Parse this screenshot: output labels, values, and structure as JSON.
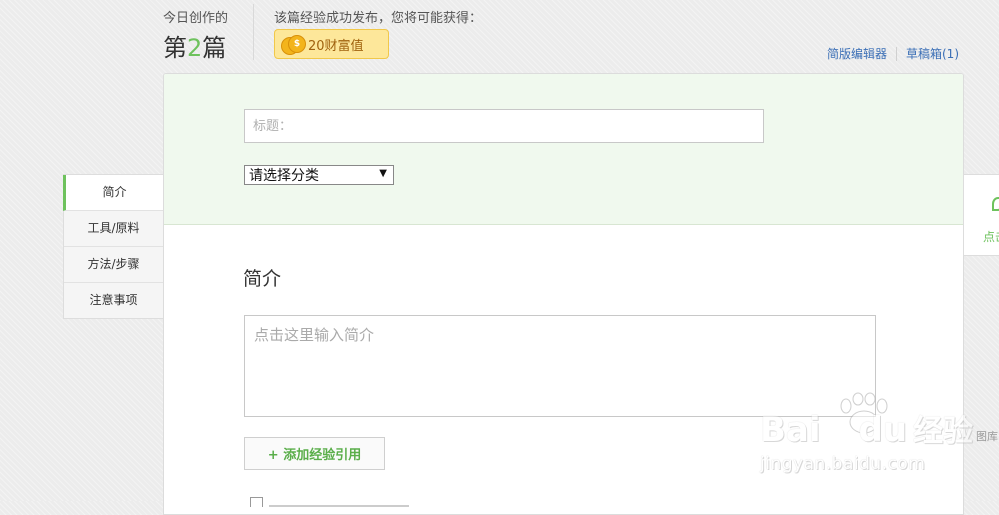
{
  "header": {
    "today_label": "今日创作的",
    "today_prefix": "第",
    "today_number": "2",
    "today_suffix": "篇",
    "reward_label": "该篇经验成功发布，您将可能获得：",
    "reward_badge": "20财富值",
    "links": {
      "simple_editor": "简版编辑器",
      "drafts": "草稿箱",
      "drafts_count": "(1)"
    }
  },
  "form": {
    "title_placeholder": "标题：",
    "category_selected": "请选择分类",
    "intro_heading": "简介",
    "intro_placeholder": "点击这里输入简介",
    "add_reference": "+ 添加经验引用"
  },
  "side_nav": {
    "items": [
      {
        "label": "简介"
      },
      {
        "label": "工具/原料"
      },
      {
        "label": "方法/步骤"
      },
      {
        "label": "注意事项"
      }
    ]
  },
  "right_panel": {
    "label": "点击",
    "gallery_label": "图库"
  },
  "watermark": {
    "brand": "Bai",
    "brand_end": "du",
    "product": "经验",
    "url": "jingyan.baidu.com"
  },
  "colors": {
    "accent_green": "#6ec25d",
    "link_blue": "#3b6fb6",
    "badge_bg": "#fde79a"
  }
}
